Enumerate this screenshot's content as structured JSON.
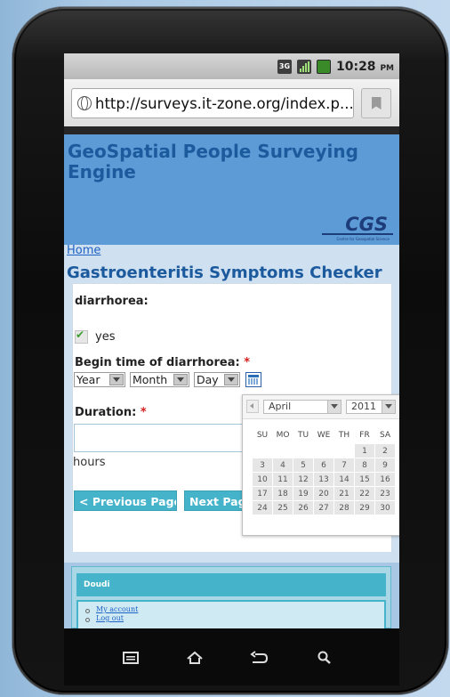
{
  "status_bar": {
    "network_label": "3G",
    "time": "10:28",
    "ampm": "PM"
  },
  "browser": {
    "url": "http://surveys.it-zone.org/index.p..."
  },
  "site": {
    "title": "GeoSpatial People Surveying Engine",
    "logo_text": "CGS",
    "logo_subtext": "Centre for Geospatial Science"
  },
  "breadcrumb": {
    "home": "Home"
  },
  "page": {
    "title": "Gastroenteritis Symptoms Checker"
  },
  "form": {
    "q1_label": "diarrhorea:",
    "q1_option": "yes",
    "q2_label": "Begin time of diarrhorea:",
    "required_mark": "*",
    "year_select": "Year",
    "month_select": "Month",
    "day_select": "Day",
    "q3_label": "Duration:",
    "duration_value": "",
    "duration_unit": "hours",
    "prev_button": "< Previous Page",
    "next_button": "Next Pag"
  },
  "datepicker": {
    "month": "April",
    "year": "2011",
    "weekdays": [
      "SU",
      "MO",
      "TU",
      "WE",
      "TH",
      "FR",
      "SA"
    ],
    "weeks": [
      [
        "",
        "",
        "",
        "",
        "",
        "1",
        "2"
      ],
      [
        "3",
        "4",
        "5",
        "6",
        "7",
        "8",
        "9"
      ],
      [
        "10",
        "11",
        "12",
        "13",
        "14",
        "15",
        "16"
      ],
      [
        "17",
        "18",
        "19",
        "20",
        "21",
        "22",
        "23"
      ],
      [
        "24",
        "25",
        "26",
        "27",
        "28",
        "29",
        "30"
      ]
    ]
  },
  "footer": {
    "block_title": "Doudi",
    "links": [
      "My account",
      "Log out"
    ]
  },
  "colors": {
    "accent": "#45b3c9",
    "title_blue": "#1c5a9e",
    "required_red": "#d52020"
  },
  "icons": {
    "nav": [
      "menu-icon",
      "home-icon",
      "back-icon",
      "search-icon"
    ]
  }
}
